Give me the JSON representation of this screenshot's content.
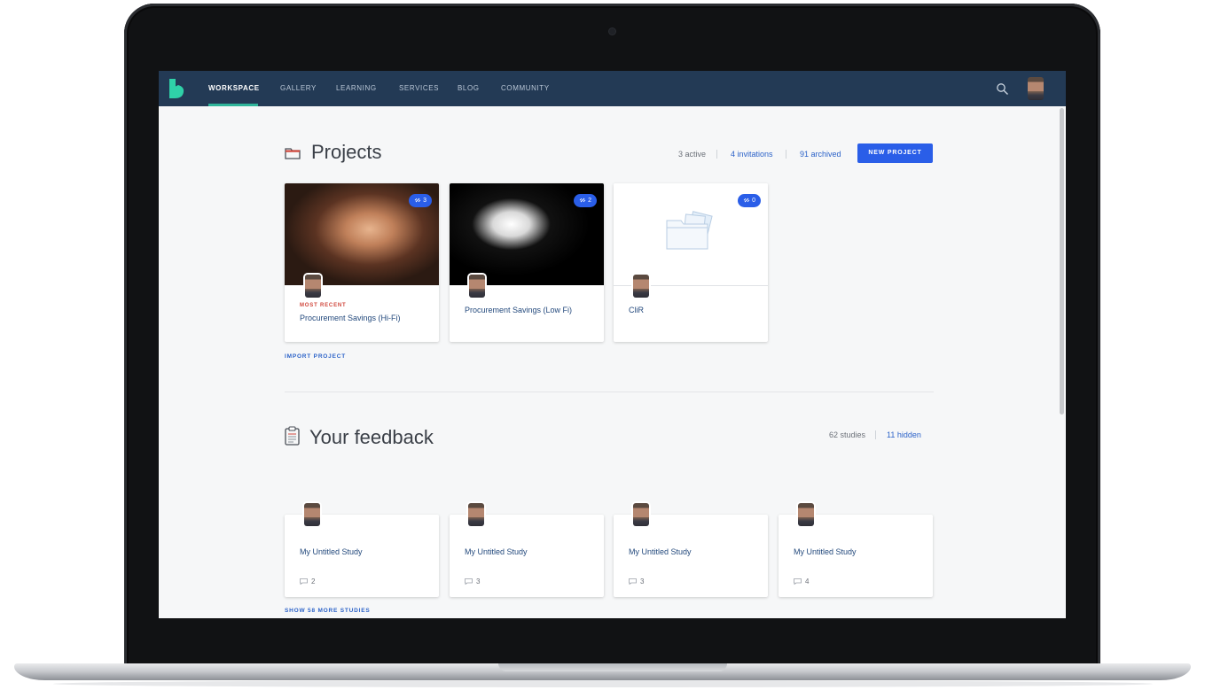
{
  "nav": {
    "items": [
      "WORKSPACE",
      "GALLERY",
      "LEARNING",
      "SERVICES",
      "BLOG",
      "COMMUNITY"
    ],
    "active": "WORKSPACE"
  },
  "projects": {
    "title": "Projects",
    "stats": {
      "active": "3 active",
      "invitations": "4 invitations",
      "archived": "91 archived"
    },
    "new_button": "NEW PROJECT",
    "cards": [
      {
        "kicker": "MOST RECENT",
        "title": "Procurement Savings (Hi-Fi)",
        "badge": "3"
      },
      {
        "kicker": "",
        "title": "Procurement Savings (Low Fi)",
        "badge": "2"
      },
      {
        "kicker": "",
        "title": "CliR",
        "badge": "0"
      }
    ],
    "import_link": "IMPORT PROJECT"
  },
  "feedback": {
    "title": "Your feedback",
    "stats": {
      "studies": "62 studies",
      "hidden": "11 hidden"
    },
    "studies": [
      {
        "title": "My Untitled Study",
        "comments": "2"
      },
      {
        "title": "My Untitled Study",
        "comments": "3"
      },
      {
        "title": "My Untitled Study",
        "comments": "3"
      },
      {
        "title": "My Untitled Study",
        "comments": "4"
      }
    ],
    "show_more": "SHOW 58 MORE STUDIES"
  },
  "colors": {
    "navbar": "#233a55",
    "accent_underline": "#2fb59a",
    "primary_button": "#2a5ee8",
    "link": "#2b62c8",
    "kicker": "#d0463b"
  },
  "icons": [
    "brand-logo-icon",
    "search-icon",
    "folder-icon",
    "clipboard-icon",
    "link-icon",
    "comment-icon"
  ]
}
